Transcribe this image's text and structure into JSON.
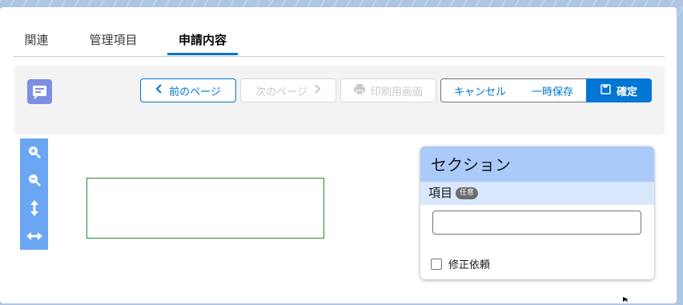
{
  "tabs": [
    {
      "label": "関連"
    },
    {
      "label": "管理項目"
    },
    {
      "label": "申請内容",
      "active": true
    }
  ],
  "toolbar": {
    "prev_label": "前のページ",
    "next_label": "次のページ",
    "print_label": "印刷用画面",
    "cancel_label": "キャンセル",
    "save_draft_label": "一時保存",
    "confirm_label": "確定"
  },
  "zoom_tools": [
    "zoom-in-icon",
    "zoom-out-icon",
    "fit-height-icon",
    "fit-width-icon"
  ],
  "section": {
    "title": "セクション",
    "field_label": "項目",
    "field_badge": "任意",
    "input_value": "",
    "checkbox_label": "修正依頼",
    "checkbox_checked": false
  },
  "colors": {
    "brand": "#0176d3",
    "panel_header": "#aacbfa",
    "field_header": "#d9e7fc",
    "zoom_bar": "#6aa6f2",
    "highlight_box": "#2e8a2e"
  }
}
